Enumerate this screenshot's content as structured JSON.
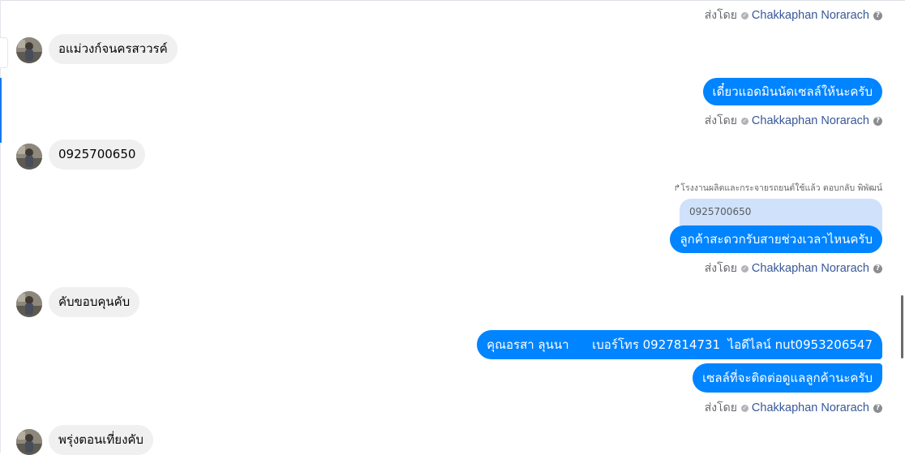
{
  "sent_by_label": "ส่งโดย",
  "agent_name": "Chakkaphan Norarach",
  "icons": {
    "verified": "check-circle-icon",
    "help": "question-circle-icon",
    "reply": "reply-arrow-icon"
  },
  "colors": {
    "outgoing_bubble": "#0084ff",
    "incoming_bubble": "#f0f0f0",
    "quoted_bubble": "#cfe1fb",
    "agent_link": "#385898"
  },
  "messages": {
    "in1": "อแม่วงก์จนครสววรค์",
    "out1": "เดี๋ยวแอดมินนัดเซลล์ให้นะครับ",
    "in2": "0925700650",
    "reply_note": "โรงงานผลิตและกระจายรถยนต์ใช้แล้ว ตอบกลับ พิพัฒน์",
    "quoted": "0925700650",
    "out2": "ลูกค้าสะดวกรับสายช่วงเวลาไหนครับ",
    "in3": "คับขอบคุนคับ",
    "out3": "คุณอรสา ลุนนา      เบอร์โทร 0927814731  ไอดีไลน์ nut0953206547",
    "out4": "เซลล์ที่จะติดต่อดูแลลูกค้านะครับ",
    "in4": "พรุ่งตอนเที่ยงคับ"
  }
}
